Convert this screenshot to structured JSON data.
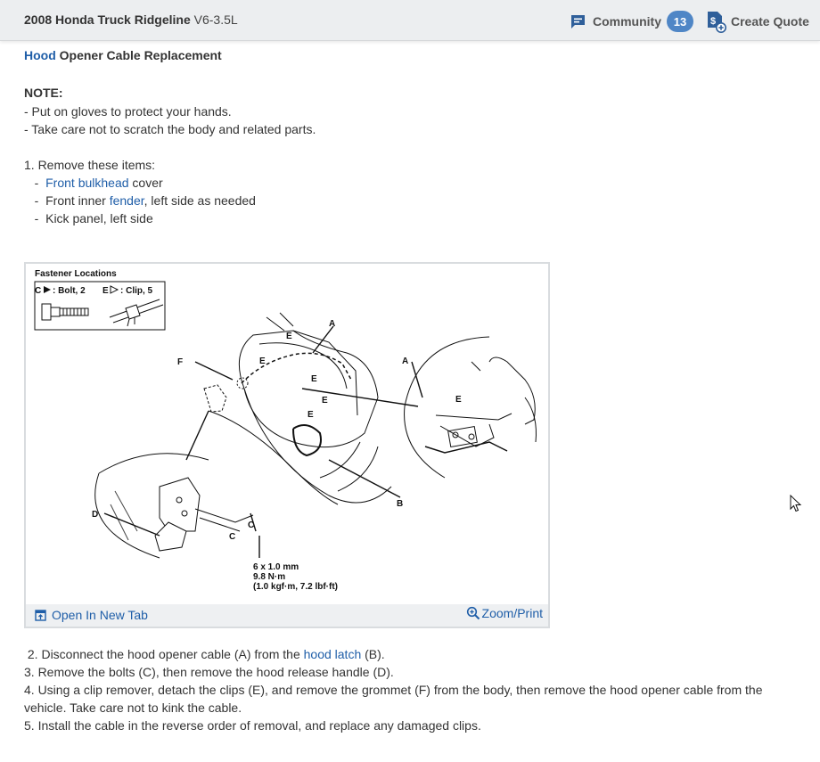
{
  "header": {
    "vehicle_model": "2008 Honda Truck Ridgeline",
    "vehicle_engine": "V6-3.5L",
    "community_label": "Community",
    "community_count": "13",
    "create_quote_label": "Create Quote"
  },
  "article": {
    "title_link": "Hood",
    "title_rest": "Opener Cable Replacement",
    "note_heading": "NOTE:",
    "note_1": " -  Put on gloves to protect your hands.",
    "note_2": " -  Take care not to scratch the body and related parts.",
    "step_1": " 1. Remove these items:",
    "item_1_pre": "   -  ",
    "item_1_link": "Front bulkhead",
    "item_1_post": " cover",
    "item_2_pre": "   -  Front inner ",
    "item_2_link": "fender",
    "item_2_post": ", left side as needed",
    "item_3": "   -  Kick panel, left side"
  },
  "figure": {
    "legend_title": "Fastener Locations",
    "legend_c": "C",
    "legend_bolt": ": Bolt, 2",
    "legend_e": "E",
    "legend_clip": ": Clip, 5",
    "spec_1": "6 x 1.0 mm",
    "spec_2": "9.8 N·m",
    "spec_3": "(1.0 kgf·m, 7.2 lbf·ft)",
    "label_a": "A",
    "label_b": "B",
    "label_c": "C",
    "label_d": "D",
    "label_e": "E",
    "label_f": "F",
    "open_new_tab": "Open In New Tab",
    "zoom_print": "Zoom/Print"
  },
  "steps": {
    "step_2_pre": " 2. Disconnect the hood opener cable (A) from the ",
    "step_2_link": "hood latch",
    "step_2_post": " (B).",
    "step_3": " 3. Remove the bolts (C), then remove the hood release handle (D).",
    "step_4": " 4. Using a clip remover, detach the clips (E), and remove the grommet (F) from the body, then remove the hood opener cable from the vehicle. Take care not to kink the cable.",
    "step_5": " 5. Install the cable in the reverse order of removal, and replace any damaged clips."
  },
  "colors": {
    "link": "#1f5ea8",
    "badge": "#4f86c6",
    "header_bg": "#eceef0",
    "icon_blue": "#2f5f9a"
  },
  "icons": {
    "community": "chat-bubble-icon",
    "create_quote": "dollar-document-icon",
    "open_tab": "open-new-tab-icon",
    "zoom": "zoom-in-icon",
    "cursor": "mouse-pointer-icon"
  }
}
